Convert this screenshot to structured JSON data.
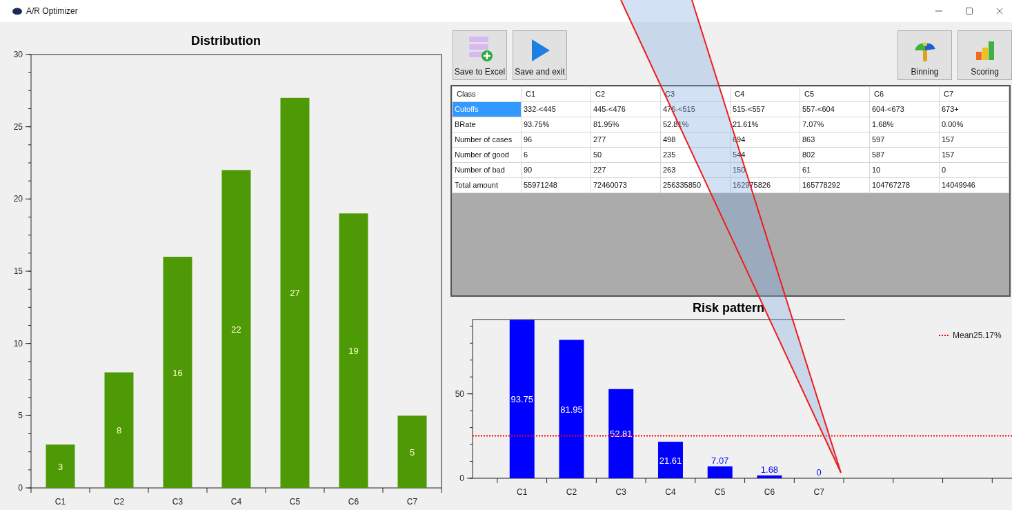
{
  "window": {
    "title": "A/R Optimizer"
  },
  "distribution": {
    "chart_data": {
      "type": "bar",
      "title": "Distribution",
      "categories": [
        "C1",
        "C2",
        "C3",
        "C4",
        "C5",
        "C6",
        "C7"
      ],
      "values": [
        3,
        8,
        16,
        22,
        27,
        19,
        5
      ],
      "ylim": [
        0,
        30
      ],
      "yticks": [
        0,
        5,
        10,
        15,
        20,
        25,
        30
      ],
      "data_labels": true,
      "color": "#4e9a06"
    }
  },
  "toolbar": {
    "left": [
      {
        "kind": "excel",
        "label": "Save to Excel"
      },
      {
        "kind": "exit",
        "label": "Save and exit"
      }
    ],
    "right": [
      {
        "kind": "binning",
        "label": "Binning"
      },
      {
        "kind": "scoring",
        "label": "Scoring"
      }
    ]
  },
  "table": {
    "columns": [
      "Class",
      "C1",
      "C2",
      "C3",
      "C4",
      "C5",
      "C6",
      "C7"
    ],
    "rows": [
      {
        "selected": true,
        "cells": [
          "Cutoffs",
          "332-<445",
          "445-<476",
          "476-<515",
          "515-<557",
          "557-<604",
          "604-<673",
          "673+"
        ]
      },
      {
        "selected": false,
        "cells": [
          "BRate",
          "93.75%",
          "81.95%",
          "52.81%",
          "21.61%",
          "7.07%",
          "1.68%",
          "0.00%"
        ]
      },
      {
        "selected": false,
        "cells": [
          "Number of cases",
          "96",
          "277",
          "498",
          "694",
          "863",
          "597",
          "157"
        ]
      },
      {
        "selected": false,
        "cells": [
          "Number of good",
          "6",
          "50",
          "235",
          "544",
          "802",
          "587",
          "157"
        ]
      },
      {
        "selected": false,
        "cells": [
          "Number of bad",
          "90",
          "227",
          "263",
          "150",
          "61",
          "10",
          "0"
        ]
      },
      {
        "selected": false,
        "cells": [
          "Total amount",
          "55971248",
          "72460073",
          "256335850",
          "162975826",
          "165778292",
          "104767278",
          "14049946"
        ]
      }
    ]
  },
  "risk": {
    "chart_data": {
      "type": "bar",
      "title": "Risk pattern",
      "categories": [
        "C1",
        "C2",
        "C3",
        "C4",
        "C5",
        "C6",
        "C7"
      ],
      "values": [
        93.75,
        81.95,
        52.81,
        21.61,
        7.07,
        1.68,
        0
      ],
      "ylim": [
        0,
        94
      ],
      "yticks": [
        0,
        50
      ],
      "data_labels": true,
      "color": "#0000ff",
      "ref_lines": [
        {
          "axis": "y",
          "value": 25.17,
          "label": "Mean25.17%",
          "color": "#ff0000"
        }
      ]
    }
  }
}
